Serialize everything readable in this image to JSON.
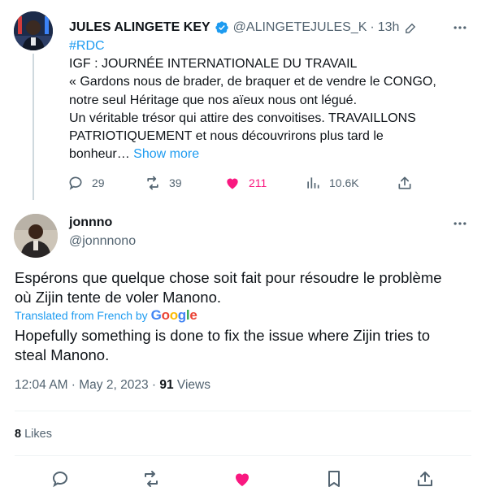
{
  "parent_tweet": {
    "author_name": "JULES ALINGETE KEY",
    "author_handle": "@ALINGETEJULES_K",
    "separator": "·",
    "time": "13h",
    "hashtag": "#RDC",
    "lines": [
      "IGF : JOURNÉE INTERNATIONALE DU TRAVAIL",
      "« Gardons nous de brader, de braquer et de vendre le CONGO,",
      "notre seul Héritage que nos aïeux nous ont légué.",
      "Un véritable trésor qui attire des convoitises. TRAVAILLONS",
      "PATRIOTIQUEMENT et nous découvrirons plus tard le"
    ],
    "last_line_text": "bonheur…",
    "show_more": "Show more",
    "stats": {
      "replies": "29",
      "retweets": "39",
      "likes": "211",
      "views": "10.6K"
    },
    "icons": [
      "verified-badge-icon",
      "edit-icon",
      "more-icon",
      "reply-icon",
      "retweet-icon",
      "heart-filled-icon",
      "views-icon",
      "share-icon"
    ]
  },
  "reply_tweet": {
    "author_name": "jonnno",
    "author_handle": "@jonnnono",
    "text_lines": [
      "Espérons que quelque chose soit fait pour résoudre le problème",
      "où Zijin tente de voler Manono."
    ],
    "translated_label": "Translated from French by",
    "translator": "Google",
    "translation_lines": [
      "Hopefully something is done to fix the issue where Zijin tries to",
      "steal Manono."
    ],
    "timestamp": "12:04 AM · May 2, 2023 ·",
    "views_count": "91",
    "views_label": "Views",
    "likes_count": "8",
    "likes_label": "Likes"
  },
  "colors": {
    "accent": "#1d9bf0",
    "like": "#f91880",
    "secondary_text": "#536471",
    "divider": "#eff3f4"
  }
}
